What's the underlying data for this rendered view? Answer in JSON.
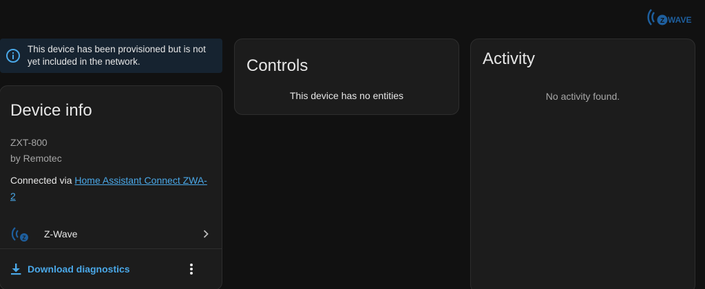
{
  "branding": {
    "logo_text": "WAVE",
    "accent": "#1e5f9e"
  },
  "alert": {
    "icon": "info-icon",
    "text": "This device has been provisioned but is not yet included in the network.",
    "color": "#4aa8e8"
  },
  "device_info": {
    "title": "Device info",
    "model": "ZXT-800",
    "manufacturer": "by Remotec",
    "connected_prefix": "Connected via ",
    "connected_link": "Home Assistant Connect ZWA-2",
    "integration": {
      "icon": "zwave-icon",
      "label": "Z-Wave"
    },
    "download_label": "Download diagnostics",
    "link_color": "#4aa8e8"
  },
  "controls": {
    "title": "Controls",
    "empty_text": "This device has no entities"
  },
  "activity": {
    "title": "Activity",
    "empty_text": "No activity found."
  }
}
